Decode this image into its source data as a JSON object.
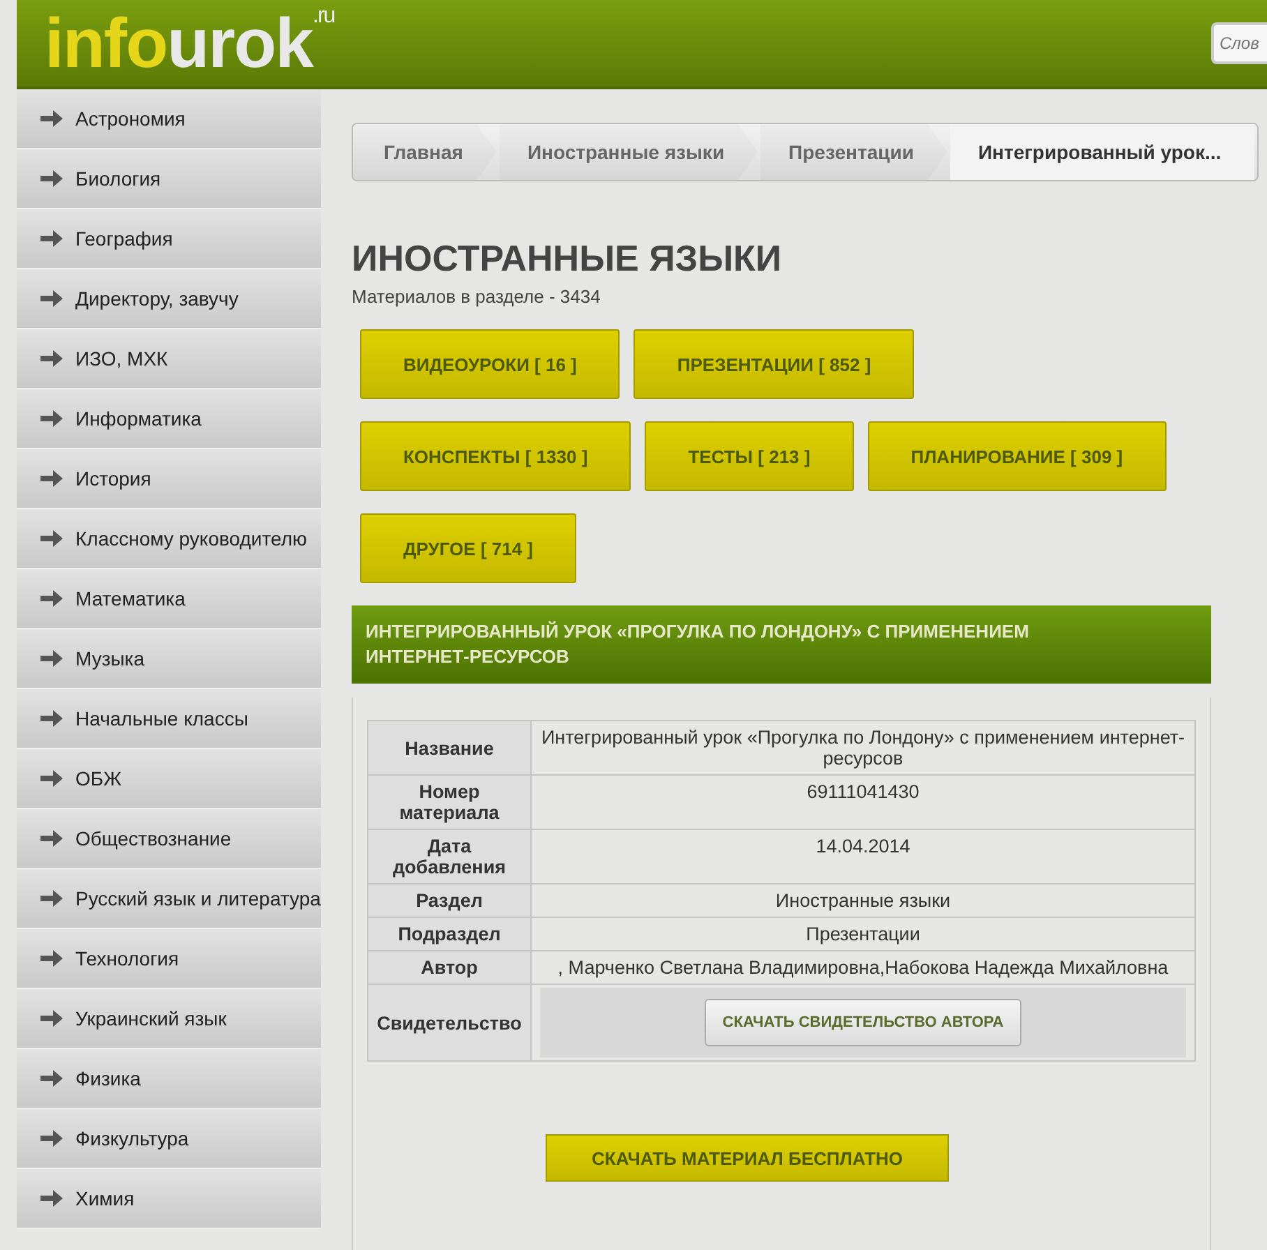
{
  "header": {
    "logo": {
      "main": "info",
      "accent": "urok",
      "domain": ".ru"
    },
    "search": {
      "placeholder": "Слов"
    }
  },
  "sidebar": {
    "items": [
      {
        "label": "Астрономия"
      },
      {
        "label": "Биология"
      },
      {
        "label": "География"
      },
      {
        "label": "Директору, завучу"
      },
      {
        "label": "ИЗО, МХК"
      },
      {
        "label": "Информатика"
      },
      {
        "label": "История"
      },
      {
        "label": "Классному руководителю"
      },
      {
        "label": "Математика"
      },
      {
        "label": "Музыка"
      },
      {
        "label": "Начальные классы"
      },
      {
        "label": "ОБЖ"
      },
      {
        "label": "Обществознание"
      },
      {
        "label": "Русский язык и литература"
      },
      {
        "label": "Технология"
      },
      {
        "label": "Украинский язык"
      },
      {
        "label": "Физика"
      },
      {
        "label": "Физкультура"
      },
      {
        "label": "Химия"
      }
    ]
  },
  "breadcrumb": [
    {
      "label": "Главная",
      "selected": false
    },
    {
      "label": "Иностранные языки",
      "selected": false
    },
    {
      "label": "Презентации",
      "selected": false
    },
    {
      "label": "Интегрированный урок...",
      "selected": true
    }
  ],
  "section": {
    "title": "ИНОСТРАННЫЕ ЯЗЫКИ",
    "count": "Материалов в разделе - 3434"
  },
  "category_buttons": [
    [
      "ВИДЕОУРОКИ [ 16 ]",
      "ПРЕЗЕНТАЦИИ [ 852 ]"
    ],
    [
      "КОНСПЕКТЫ [ 1330 ]",
      "ТЕСТЫ [ 213 ]",
      "ПЛАНИРОВАНИЕ [ 309 ]"
    ],
    [
      "ДРУГОЕ [ 714 ]"
    ]
  ],
  "material": {
    "title": "ИНТЕГРИРОВАННЫЙ УРОК «ПРОГУЛКА ПО ЛОНДОНУ» С ПРИМЕНЕНИЕМ ИНТЕРНЕТ-РЕСУРСОВ",
    "rows": [
      {
        "kind": "text",
        "label": "Название",
        "value": "Интегрированный урок «Прогулка по Лондону» с применением интернет-ресурсов"
      },
      {
        "kind": "text",
        "label": "Номер материала",
        "value": "69111041430"
      },
      {
        "kind": "text",
        "label": "Дата добавления",
        "value": "14.04.2014"
      },
      {
        "kind": "text",
        "label": "Раздел",
        "value": "Иностранные языки"
      },
      {
        "kind": "text",
        "label": "Подраздел",
        "value": "Презентации"
      },
      {
        "kind": "text",
        "label": "Автор",
        "value": ", Марченко Светлана Владимировна,Набокова Надежда Михайловна"
      },
      {
        "kind": "button",
        "label": "Свидетельство",
        "value": "СКАЧАТЬ СВИДЕТЕЛЬСТВО АВТОРА"
      }
    ],
    "download_button": "СКАЧАТЬ МАТЕРИАЛ БЕСПЛАТНО"
  }
}
